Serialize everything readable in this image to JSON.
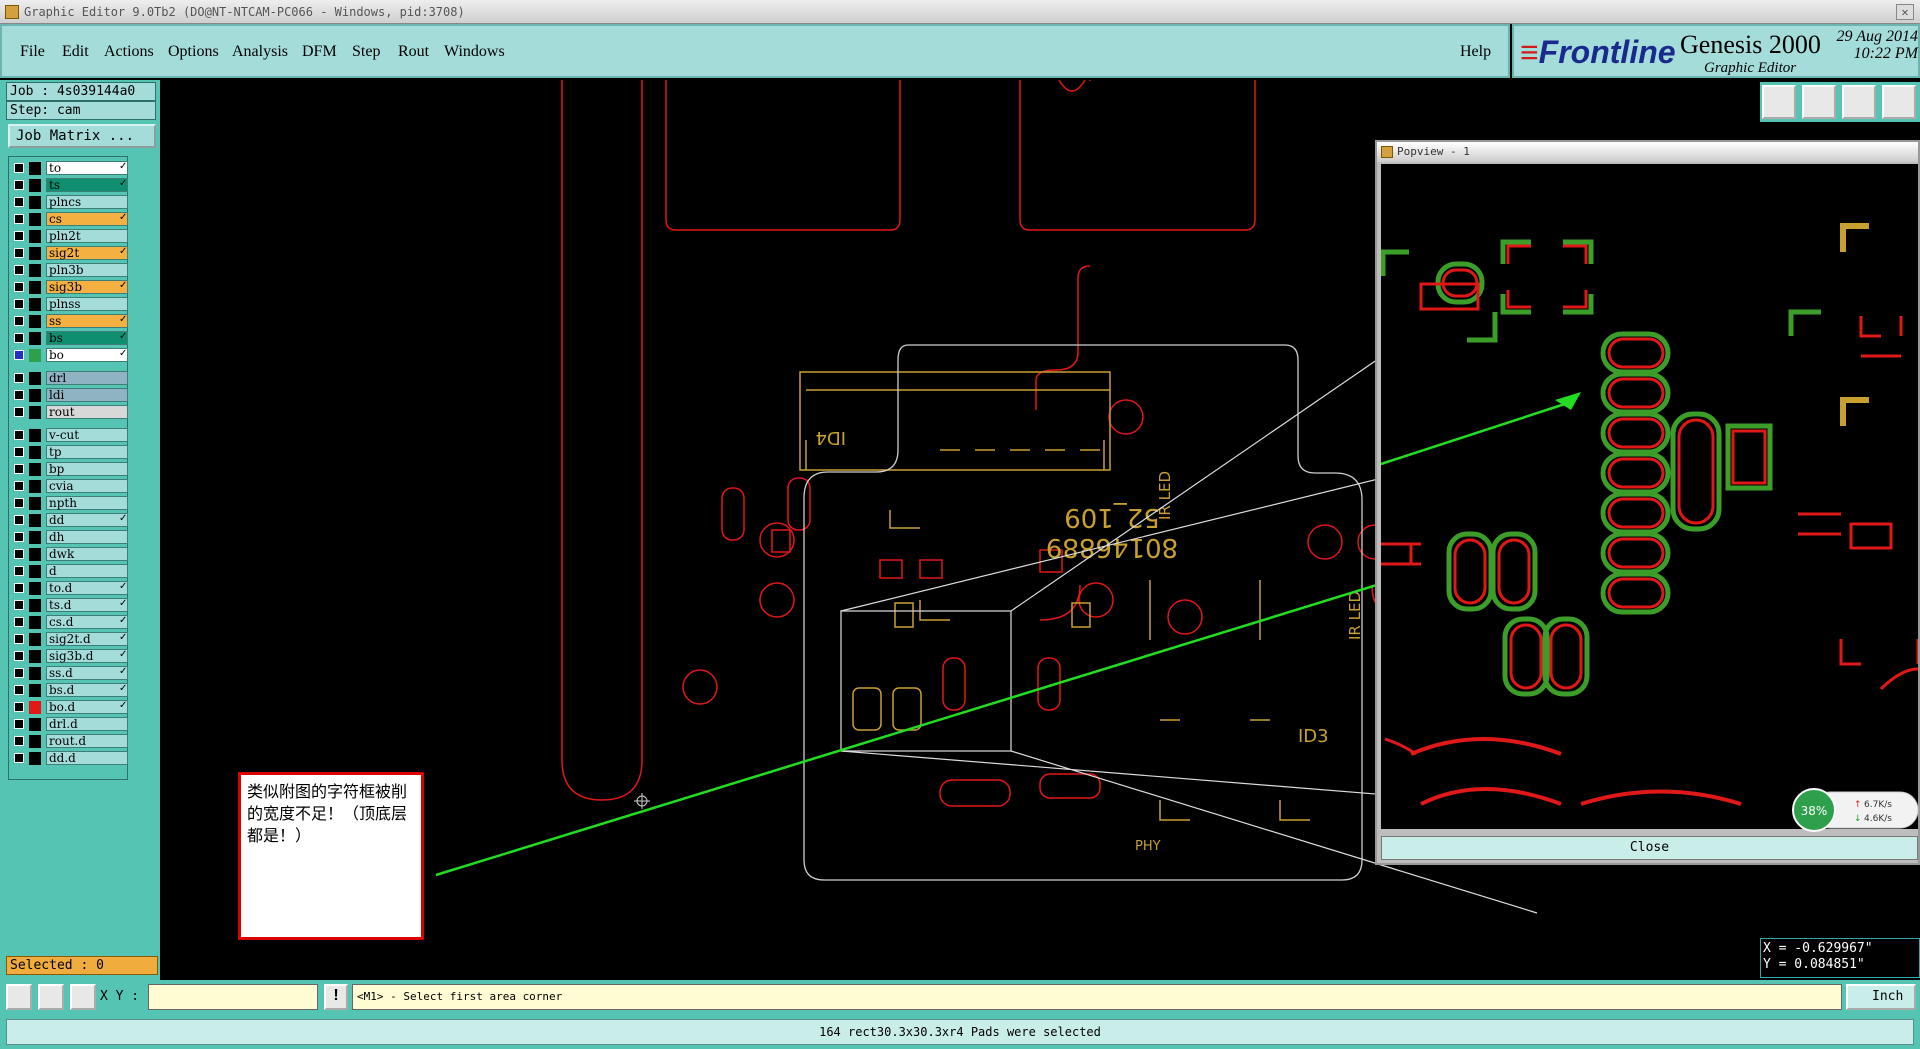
{
  "window": {
    "title": "Graphic Editor 9.0Tb2 (DO@NT-NTCAM-PC066 - Windows, pid:3708)"
  },
  "menu": [
    "File",
    "Edit",
    "Actions",
    "Options",
    "Analysis",
    "DFM",
    "Step",
    "Rout",
    "Windows"
  ],
  "help_label": "Help",
  "brand": {
    "logo": "Frontline",
    "product": "Genesis 2000",
    "subtitle": "Graphic Editor",
    "date": "29 Aug 2014",
    "time": "10:22 PM"
  },
  "job": {
    "job": "Job : 4s039144a0",
    "step": "Step: cam",
    "matrix_button": "Job Matrix ..."
  },
  "layers": [
    {
      "name": "to",
      "color": "#ffffff",
      "tick": true
    },
    {
      "name": "ts",
      "color": "#0f8f6f",
      "tick": true
    },
    {
      "name": "plncs",
      "color": "#a4dcd9",
      "tick": false
    },
    {
      "name": "cs",
      "color": "#f4b040",
      "tick": true
    },
    {
      "name": "pln2t",
      "color": "#a4dcd9",
      "tick": false
    },
    {
      "name": "sig2t",
      "color": "#f4b040",
      "tick": true
    },
    {
      "name": "pln3b",
      "color": "#a4dcd9",
      "tick": false
    },
    {
      "name": "sig3b",
      "color": "#f4b040",
      "tick": true
    },
    {
      "name": "plnss",
      "color": "#a4dcd9",
      "tick": false
    },
    {
      "name": "ss",
      "color": "#f4b040",
      "tick": true
    },
    {
      "name": "bs",
      "color": "#0f8f6f",
      "tick": true
    },
    {
      "name": "bo",
      "color": "#ffffff",
      "tick": true
    },
    {
      "name": "drl",
      "color": "#8fb3c3",
      "tick": false
    },
    {
      "name": "ldi",
      "color": "#8fb3c3",
      "tick": false
    },
    {
      "name": "rout",
      "color": "#d8d8d8",
      "tick": false
    },
    {
      "name": "v-cut",
      "color": "#a4dcd9",
      "tick": false
    },
    {
      "name": "tp",
      "color": "#a4dcd9",
      "tick": false
    },
    {
      "name": "bp",
      "color": "#a4dcd9",
      "tick": false
    },
    {
      "name": "cvia",
      "color": "#a4dcd9",
      "tick": false
    },
    {
      "name": "npth",
      "color": "#a4dcd9",
      "tick": false
    },
    {
      "name": "dd",
      "color": "#a4dcd9",
      "tick": true
    },
    {
      "name": "dh",
      "color": "#a4dcd9",
      "tick": false
    },
    {
      "name": "dwk",
      "color": "#a4dcd9",
      "tick": false
    },
    {
      "name": "d",
      "color": "#a4dcd9",
      "tick": false
    },
    {
      "name": "to.d",
      "color": "#a4dcd9",
      "tick": true
    },
    {
      "name": "ts.d",
      "color": "#a4dcd9",
      "tick": true
    },
    {
      "name": "cs.d",
      "color": "#a4dcd9",
      "tick": true
    },
    {
      "name": "sig2t.d",
      "color": "#a4dcd9",
      "tick": true
    },
    {
      "name": "sig3b.d",
      "color": "#a4dcd9",
      "tick": true
    },
    {
      "name": "ss.d",
      "color": "#a4dcd9",
      "tick": true
    },
    {
      "name": "bs.d",
      "color": "#a4dcd9",
      "tick": true
    },
    {
      "name": "bo.d",
      "color": "#a4dcd9",
      "tick": true
    },
    {
      "name": "drl.d",
      "color": "#a4dcd9",
      "tick": false
    },
    {
      "name": "rout.d",
      "color": "#a4dcd9",
      "tick": false
    },
    {
      "name": "dd.d",
      "color": "#a4dcd9",
      "tick": false
    }
  ],
  "selected": "Selected : 0",
  "board_text": {
    "part": "52_109",
    "serial": "80146889",
    "ir_led": "IR LED",
    "id3": "ID3",
    "id4": "ID4",
    "phy": "PHY"
  },
  "popview": {
    "title": "Popview - 1",
    "close_label": "Close"
  },
  "net_widget": {
    "percent": "38%",
    "up": "6.7K/s",
    "down": "4.6K/s"
  },
  "coords": {
    "x": "X = -0.629967\"",
    "y": "Y = 0.084851\""
  },
  "note_text": "类似附图的字符框被削的宽度不足！（顶底层都是！）",
  "cmd": {
    "xy_label": "X Y :",
    "xy_value": "",
    "warn": "!",
    "prompt": "<M1> - Select first area corner",
    "unit": "Inch"
  },
  "status": "164 rect30.3x30.3xr4 Pads were selected",
  "colors": {
    "panel": "#56c4b2",
    "menubar": "#a4dcd9",
    "outline_red": "#e01818",
    "silk_yellow": "#c8a032",
    "mask_green": "#3c9e28",
    "annotation_green": "#22dd22"
  }
}
